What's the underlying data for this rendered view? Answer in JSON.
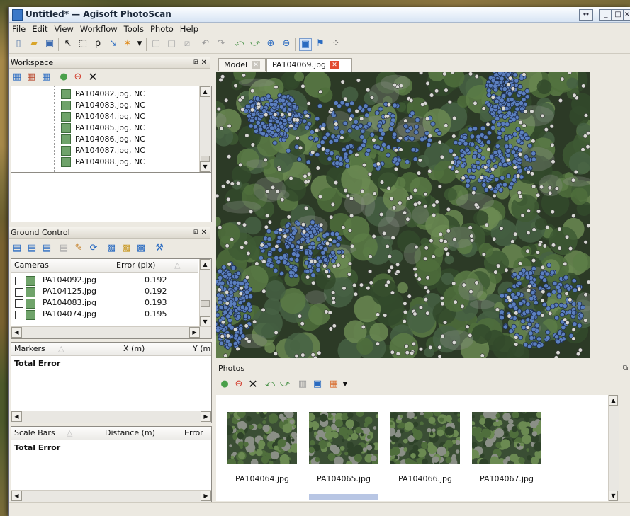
{
  "window": {
    "title": "Untitled* — Agisoft PhotoScan",
    "controls": {
      "restore": "↔",
      "minimize": "_",
      "maximize": "□",
      "close": "×"
    }
  },
  "menu": [
    "File",
    "Edit",
    "View",
    "Workflow",
    "Tools",
    "Photo",
    "Help"
  ],
  "workspace": {
    "title": "Workspace",
    "items": [
      "PA104082.jpg, NC",
      "PA104083.jpg, NC",
      "PA104084.jpg, NC",
      "PA104085.jpg, NC",
      "PA104086.jpg, NC",
      "PA104087.jpg, NC",
      "PA104088.jpg, NC"
    ]
  },
  "ground_control": {
    "title": "Ground Control",
    "cameras_header": "Cameras",
    "error_header": "Error (pix)",
    "rows": [
      {
        "name": "PA104092.jpg",
        "error": "0.192"
      },
      {
        "name": "PA104125.jpg",
        "error": "0.192"
      },
      {
        "name": "PA104083.jpg",
        "error": "0.193"
      },
      {
        "name": "PA104074.jpg",
        "error": "0.195"
      }
    ],
    "markers": {
      "header": "Markers",
      "x_header": "X (m)",
      "y_header": "Y (m",
      "total": "Total Error"
    },
    "scale_bars": {
      "header": "Scale Bars",
      "distance_header": "Distance (m)",
      "error_header": "Error",
      "total": "Total Error"
    }
  },
  "tabs": [
    {
      "label": "Model",
      "active": false
    },
    {
      "label": "PA104069.jpg",
      "active": true
    }
  ],
  "photos": {
    "title": "Photos",
    "items": [
      "PA104064.jpg",
      "PA104065.jpg",
      "PA104066.jpg",
      "PA104067.jpg"
    ],
    "selected_index": 1
  },
  "colors": {
    "tiepoint_valid": "#5b7fbf",
    "tiepoint_invalid": "#d8d8d4",
    "accent_close": "#e24b30"
  }
}
